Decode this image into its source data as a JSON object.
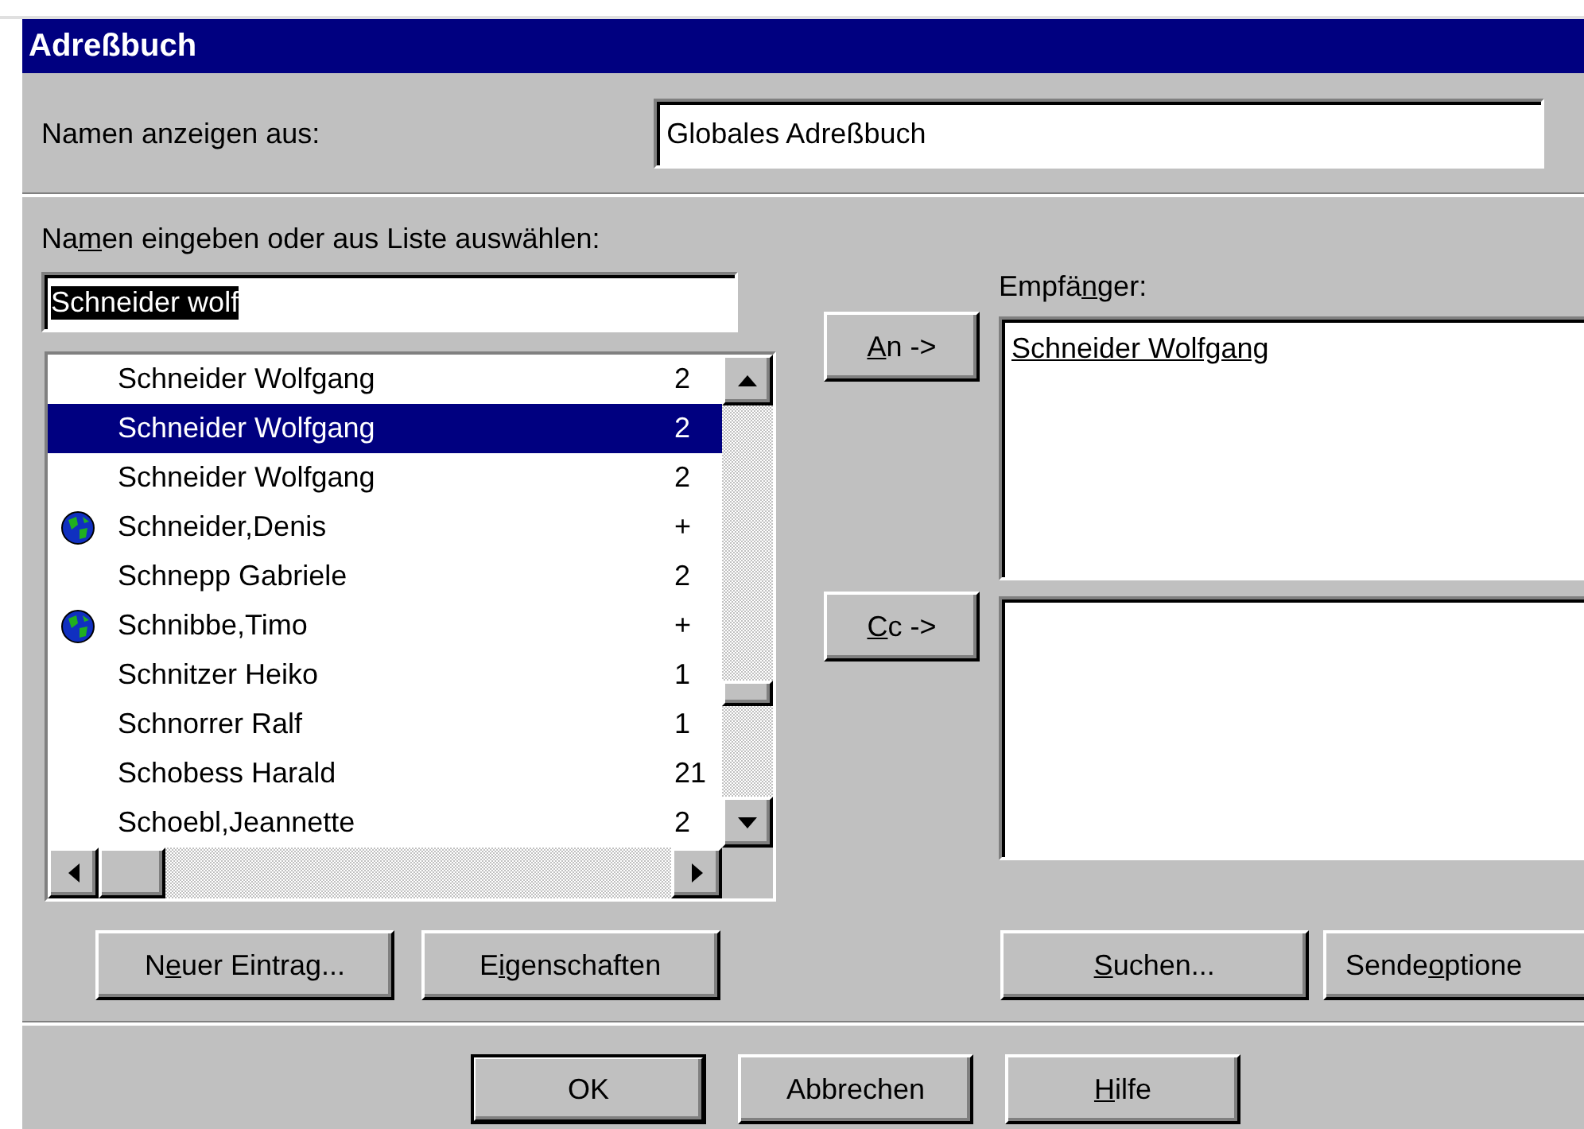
{
  "window": {
    "title": "Adreßbuch"
  },
  "source": {
    "label": "Namen anzeigen aus:",
    "value": "Globales Adreßbuch"
  },
  "search": {
    "label": {
      "pre": "Na",
      "key": "m",
      "post": "en eingeben oder aus Liste auswählen:"
    },
    "value": "Schneider wolf",
    "text_selected": true
  },
  "names": [
    {
      "name": "Schneider Wolfgang",
      "column_2": "2",
      "selected": false,
      "globe": false
    },
    {
      "name": "Schneider Wolfgang",
      "column_2": "2",
      "selected": true,
      "globe": false
    },
    {
      "name": "Schneider Wolfgang",
      "column_2": "2",
      "selected": false,
      "globe": false
    },
    {
      "name": "Schneider,Denis",
      "column_2": "+",
      "selected": false,
      "globe": true
    },
    {
      "name": "Schnepp Gabriele",
      "column_2": "2",
      "selected": false,
      "globe": false
    },
    {
      "name": "Schnibbe,Timo",
      "column_2": "+",
      "selected": false,
      "globe": true
    },
    {
      "name": "Schnitzer Heiko",
      "column_2": "1",
      "selected": false,
      "globe": false
    },
    {
      "name": "Schnorrer Ralf",
      "column_2": "1",
      "selected": false,
      "globe": false
    },
    {
      "name": "Schobess Harald",
      "column_2": "21",
      "selected": false,
      "globe": false
    },
    {
      "name": "Schoebl,Jeannette",
      "column_2": "2",
      "selected": false,
      "globe": false
    }
  ],
  "recipients": {
    "label": {
      "pre": "Empfä",
      "key": "n",
      "post": "ger:"
    },
    "to": {
      "button": {
        "key": "A",
        "post": "n ->"
      },
      "entries": [
        {
          "name": "Schneider Wolfgang",
          "resolved": true
        }
      ]
    },
    "cc": {
      "button": {
        "key": "C",
        "post": "c ->"
      }
    }
  },
  "list_buttons": [
    {
      "pre": "N",
      "key": "e",
      "post": "uer Eintrag..."
    },
    {
      "pre": "E",
      "key": "i",
      "post": "genschaften"
    }
  ],
  "recipient_buttons": [
    {
      "key": "S",
      "post": "uchen..."
    },
    {
      "pre": "Sende",
      "key": "o",
      "post": "ptione"
    }
  ],
  "dialog_buttons": [
    {
      "label": {
        "pre": "OK"
      },
      "default": true
    },
    {
      "label": {
        "pre": "Abbrechen"
      },
      "default": false
    },
    {
      "label": {
        "key": "H",
        "post": "ilfe"
      },
      "default": false
    }
  ]
}
